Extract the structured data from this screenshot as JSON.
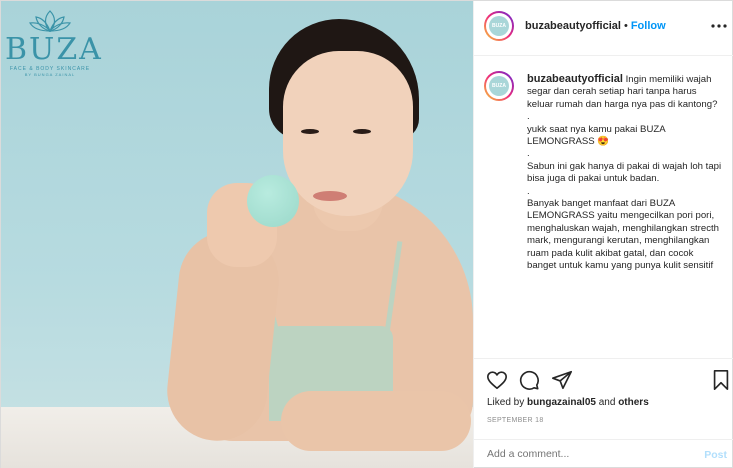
{
  "brand": {
    "name": "BUZA",
    "tagline": "FACE & BODY SKINCARE",
    "byline": "BY BUNGA ZAINAL"
  },
  "header": {
    "username": "buzabeautyofficial",
    "separator": "•",
    "follow_label": "Follow",
    "more_icon": "more-horizontal-icon"
  },
  "caption": {
    "username": "buzabeautyofficial",
    "lines": [
      "Ingin memiliki wajah segar dan cerah setiap hari tanpa harus keluar rumah dan harga nya pas di kantong?",
      ".",
      "yukk saat nya kamu pakai BUZA LEMONGRASS 😍",
      ".",
      "Sabun ini gak hanya di pakai di wajah loh tapi bisa juga di pakai untuk badan.",
      ".",
      "Banyak banget manfaat dari BUZA LEMONGRASS yaitu mengecilkan pori pori, menghaluskan wajah, menghilangkan strecth mark, mengurangi kerutan, menghilangkan ruam pada kulit akibat gatal, dan cocok banget untuk kamu yang punya kulit sensitif"
    ]
  },
  "actions": {
    "like_icon": "heart-icon",
    "comment_icon": "comment-icon",
    "share_icon": "share-icon",
    "save_icon": "bookmark-icon"
  },
  "likes": {
    "prefix": "Liked by ",
    "user": "bungazainal05",
    "middle": " and ",
    "others": "others"
  },
  "date": "SEPTEMBER 18",
  "comment": {
    "placeholder": "Add a comment...",
    "post_label": "Post"
  },
  "colors": {
    "accent": "#0095f6",
    "post_disabled": "#b2dffc",
    "brand_teal": "#3a93a8"
  }
}
